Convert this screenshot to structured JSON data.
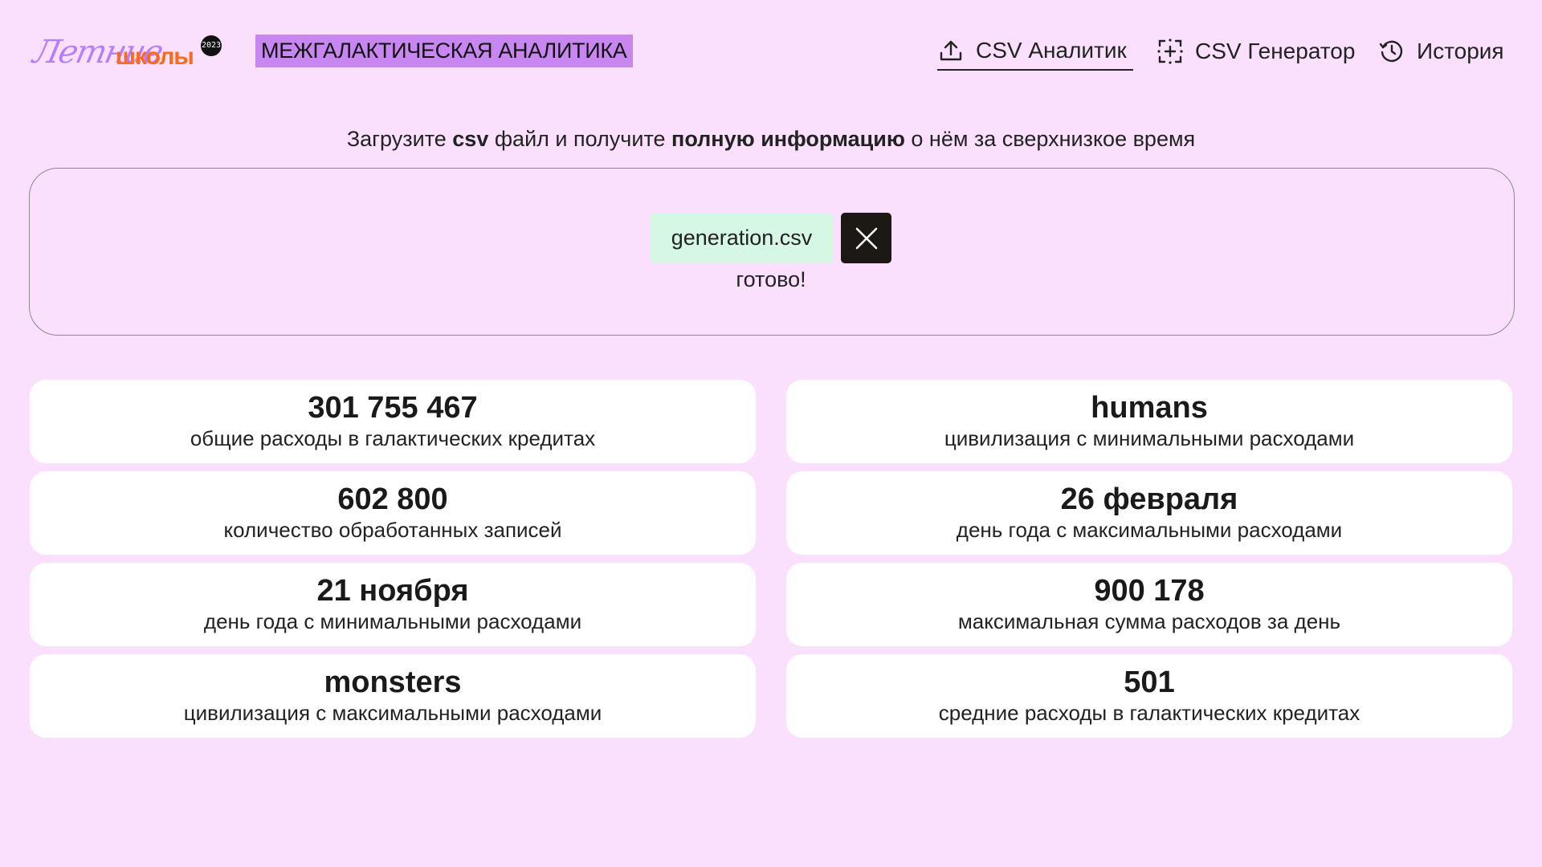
{
  "header": {
    "logo": {
      "script_text": "Летние",
      "bold_text": "школы",
      "badge": "2023"
    },
    "brand": "МЕЖГАЛАКТИЧЕСКАЯ АНАЛИТИКА",
    "nav": [
      {
        "label": "CSV Аналитик",
        "icon": "upload-icon",
        "active": true
      },
      {
        "label": "CSV Генератор",
        "icon": "add-frame-icon",
        "active": false
      },
      {
        "label": "История",
        "icon": "history-clock-icon",
        "active": false
      }
    ]
  },
  "upload": {
    "subtitle": {
      "part1": "Загрузите ",
      "bold1": "csv",
      "part2": " файл и получите ",
      "bold2": "полную информацию",
      "part3": " о нём за сверхнизкое время"
    },
    "file_name": "generation.csv",
    "remove_icon": "close-icon",
    "status": "готово!"
  },
  "stats": [
    {
      "value": "301 755 467",
      "label": "общие расходы в галактических кредитах"
    },
    {
      "value": "humans",
      "label": "цивилизация с минимальными расходами"
    },
    {
      "value": "602 800",
      "label": "количество обработанных записей"
    },
    {
      "value": "26 февраля",
      "label": "день года с максимальными расходами"
    },
    {
      "value": "21 ноября",
      "label": "день года с минимальными расходами"
    },
    {
      "value": "900 178",
      "label": "максимальная сумма расходов за день"
    },
    {
      "value": "monsters",
      "label": "цивилизация с максимальными расходами"
    },
    {
      "value": "501",
      "label": "средние расходы в галактических кредитах"
    }
  ],
  "colors": {
    "background": "#fbe0fe",
    "brand_highlight": "#c886f0",
    "file_chip": "#d6f7e4",
    "remove_button": "#1c1915",
    "card": "#ffffff",
    "logo_script": "#b57dff",
    "logo_bold": "#ff6a1a"
  }
}
